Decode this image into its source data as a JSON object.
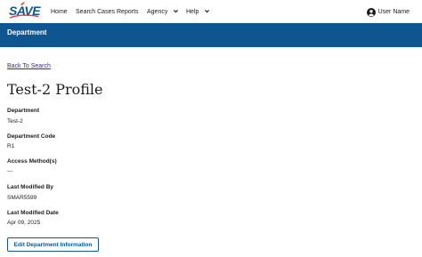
{
  "header": {
    "logo_text": "SAVE",
    "nav": {
      "home": "Home",
      "search_cases": "Search Cases",
      "reports": "Reports",
      "agency": "Agency",
      "help": "Help"
    },
    "user_label": "User Name"
  },
  "banner": {
    "title": "Department"
  },
  "main": {
    "back_link": "Back To Search",
    "page_title": "Test-2 Profile",
    "fields": [
      {
        "label": "Department",
        "value": "Test-2"
      },
      {
        "label": "Department Code",
        "value": "R1"
      },
      {
        "label": "Access Method(s)",
        "value": "---"
      },
      {
        "label": "Last Modified By",
        "value": "SMAR5599"
      },
      {
        "label": "Last Modified Date",
        "value": "Apr 09, 2025"
      }
    ],
    "edit_button": "Edit Department Information"
  },
  "colors": {
    "brand_blue": "#0f5590",
    "logo_red": "#d83933",
    "link_purple": "#3d2a8c"
  },
  "icons": {
    "nav_dropdown": "chevron-down-icon",
    "user": "user-circle-icon"
  }
}
